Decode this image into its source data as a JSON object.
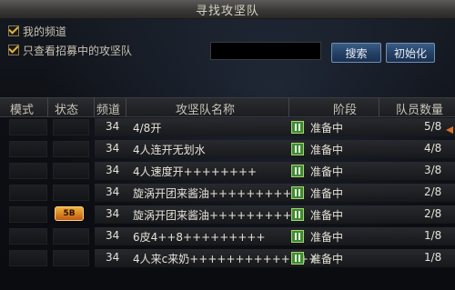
{
  "window": {
    "title": "寻找攻坚队"
  },
  "filters": {
    "my_channel_label": "我的频道",
    "recruiting_only_label": "只查看招募中的攻坚队",
    "search_value": ""
  },
  "buttons": {
    "search": "搜索",
    "reset": "初始化"
  },
  "table": {
    "headers": [
      "模式",
      "状态",
      "频道",
      "攻坚队名称",
      "阶段",
      "队员数量"
    ],
    "rows": [
      {
        "channel": "34",
        "name": "4/8开",
        "stage": "准备中",
        "members": "5/8",
        "status_badge": ""
      },
      {
        "channel": "34",
        "name": "4人连开无划水",
        "stage": "准备中",
        "members": "4/8",
        "status_badge": ""
      },
      {
        "channel": "34",
        "name": "4人速度开++++++++",
        "stage": "准备中",
        "members": "3/8",
        "status_badge": ""
      },
      {
        "channel": "34",
        "name": "旋涡开团来酱油++++++++++",
        "stage": "准备中",
        "members": "2/8",
        "status_badge": ""
      },
      {
        "channel": "34",
        "name": "旋涡开团来酱油++++++++++",
        "stage": "准备中",
        "members": "2/8",
        "status_badge": "5B"
      },
      {
        "channel": "34",
        "name": "6皮4++8+++++++++",
        "stage": "准备中",
        "members": "1/8",
        "status_badge": ""
      },
      {
        "channel": "34",
        "name": "4人来c来奶++++++++++++++",
        "stage": "准备中",
        "members": "1/8",
        "status_badge": ""
      }
    ]
  },
  "colors": {
    "accent_orange": "#d9722a",
    "stage_green": "#3e8a3a",
    "button_blue": "#244063"
  }
}
